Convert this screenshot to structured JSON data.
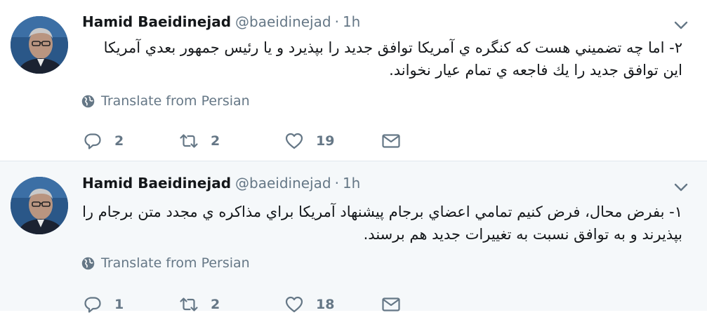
{
  "timeline": {
    "tweets": [
      {
        "author": {
          "name": "Hamid Baeidinejad",
          "handle": "@baeidinejad"
        },
        "time_separator": "·",
        "time": "1h",
        "text": "۲- اما چه تضميني هست كه كنگره ي آمريكا توافق جديد را بپذيرد و يا رئيس جمهور بعدي آمريكا اين توافق جديد را يك فاجعه ي تمام عيار نخواند.",
        "translate_label": "Translate from Persian",
        "actions": {
          "replies": "2",
          "retweets": "2",
          "likes": "19"
        }
      },
      {
        "author": {
          "name": "Hamid Baeidinejad",
          "handle": "@baeidinejad"
        },
        "time_separator": "·",
        "time": "1h",
        "text": "۱- بفرض محال، فرض كنيم تمامي اعضاي برجام پيشنهاد آمريكا براي مذاكره ي مجدد متن برجام را بپذيرند و به توافق نسبت به تغييرات جديد هم برسند.",
        "translate_label": "Translate from Persian",
        "actions": {
          "replies": "1",
          "retweets": "2",
          "likes": "18"
        }
      }
    ]
  },
  "colors": {
    "text_primary": "#14171a",
    "text_secondary": "#657786",
    "highlight_background": "#f5f8fa",
    "divider": "#e1e8ed"
  },
  "icons": {
    "reply": "reply-icon",
    "retweet": "retweet-icon",
    "like": "heart-icon",
    "direct_message": "envelope-icon",
    "translate": "globe-icon",
    "menu": "chevron-down-icon"
  }
}
